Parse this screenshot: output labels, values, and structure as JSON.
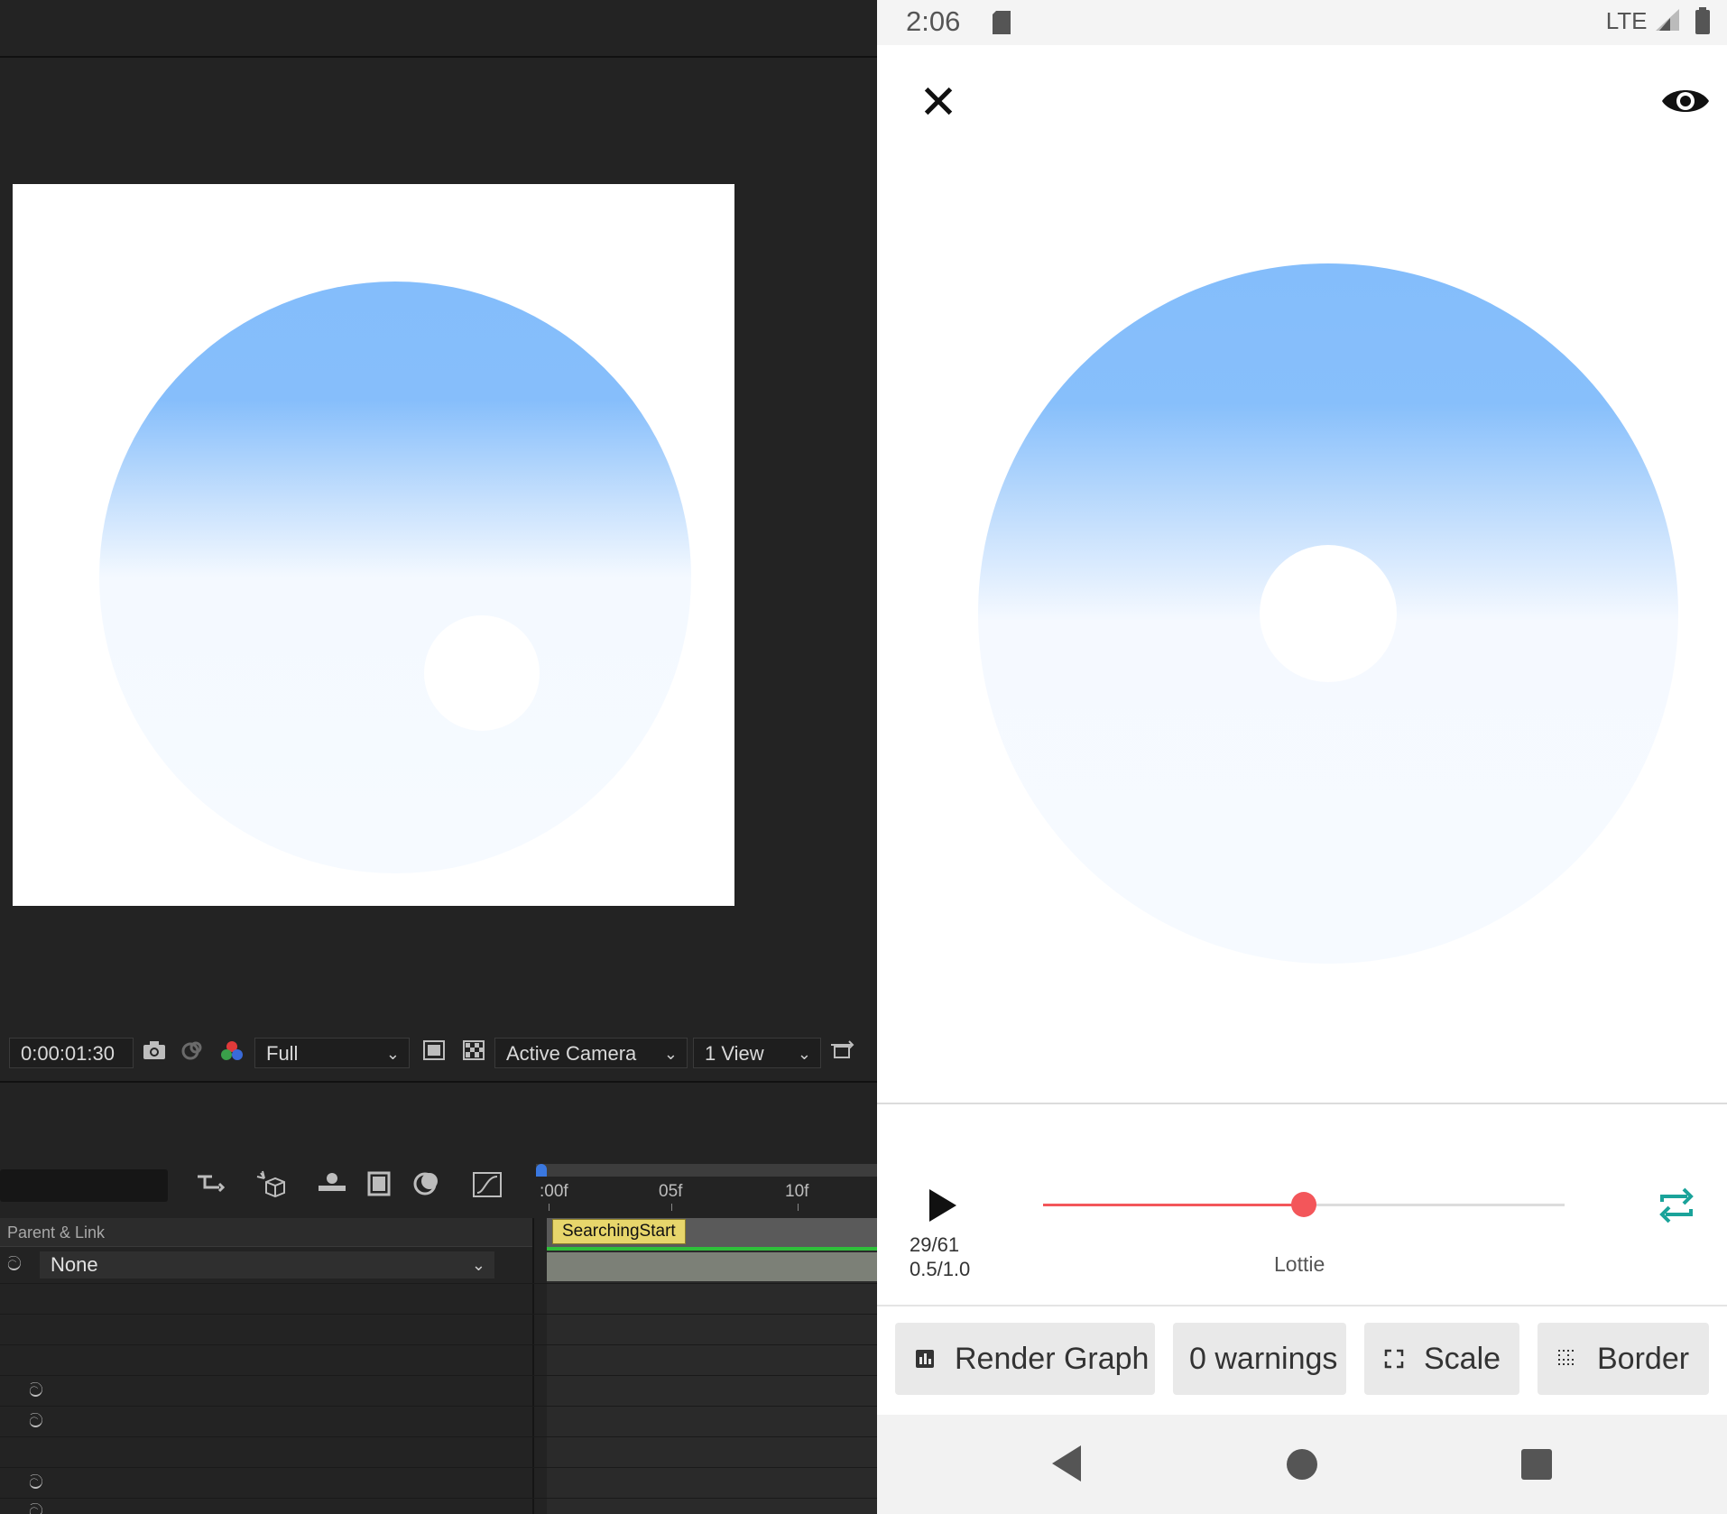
{
  "ae": {
    "viewer": {
      "timecode": "0:00:01:30",
      "resolution": "Full",
      "camera": "Active Camera",
      "views": "1 View"
    },
    "timeline": {
      "parent_header": "Parent & Link",
      "parent_value": "None",
      "ticks": [
        ":00f",
        "05f",
        "10f"
      ],
      "marker_label": "SearchingStart"
    }
  },
  "phone": {
    "status": {
      "time": "2:06",
      "network": "LTE"
    },
    "player": {
      "frame": "29/61",
      "progress_text": "0.5/1.0",
      "progress": 0.5,
      "label": "Lottie"
    },
    "chips": [
      {
        "icon": "bar-chart-icon",
        "label": "Render Graph"
      },
      {
        "icon": "",
        "label": "0 warnings"
      },
      {
        "icon": "fullscreen-icon",
        "label": "Scale"
      },
      {
        "icon": "border-grid-icon",
        "label": "Border"
      }
    ]
  },
  "colors": {
    "seek_accent": "#f3565a",
    "loop_accent": "#1aa39a",
    "disc_top": "#84bdfb",
    "disc_bottom": "#f6faff",
    "marker": "#e7d66b"
  }
}
